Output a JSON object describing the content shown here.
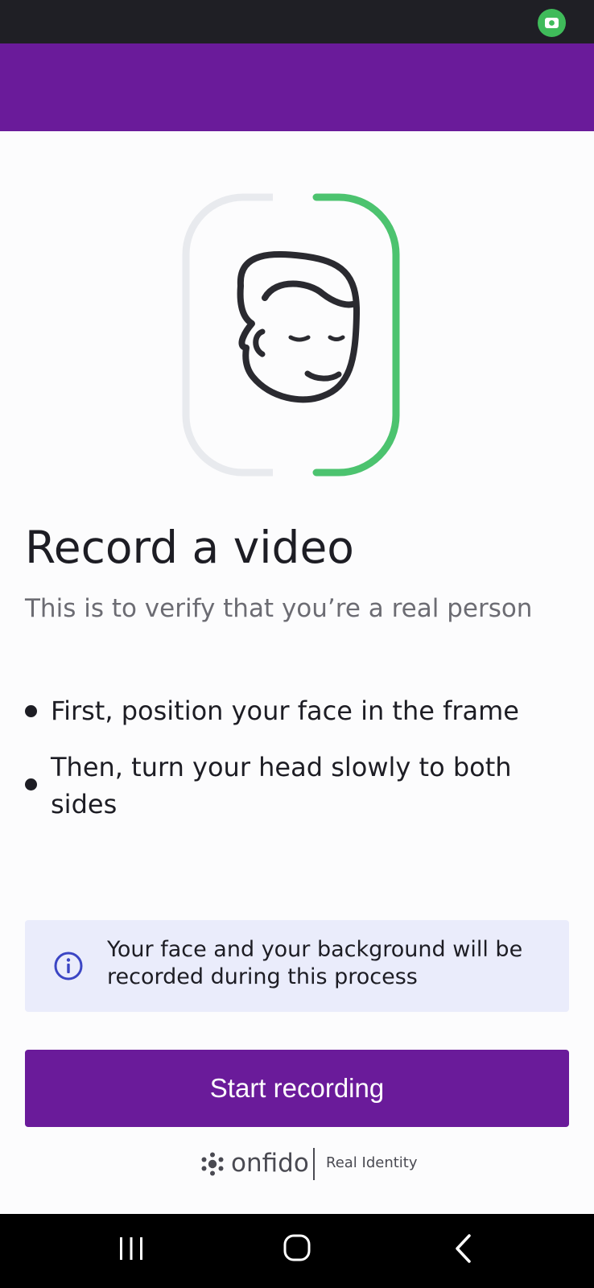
{
  "status_bar": {
    "camera_indicator_icon": "camera-icon",
    "indicator_color": "#3fbb5a"
  },
  "header": {
    "background": "#6a1b9a"
  },
  "illustration": {
    "icon": "face-turn-icon",
    "progress_color": "#4cc36f",
    "track_color": "#e8eaee"
  },
  "title": "Record a video",
  "subtitle": "This is to verify that you’re a real person",
  "instructions": [
    "First, position your face in the frame",
    "Then, turn your head slowly to both sides"
  ],
  "info": {
    "icon": "info-icon",
    "text": "Your face and your background will be recorded during this process",
    "accent": "#3b45c4"
  },
  "primary_button": {
    "label": "Start recording",
    "color": "#6a1b9a"
  },
  "footer": {
    "brand": "onfido",
    "tagline": "Real Identity"
  },
  "nav_bar": {
    "recent_icon": "recent-apps-icon",
    "home_icon": "home-icon",
    "back_icon": "back-icon"
  }
}
